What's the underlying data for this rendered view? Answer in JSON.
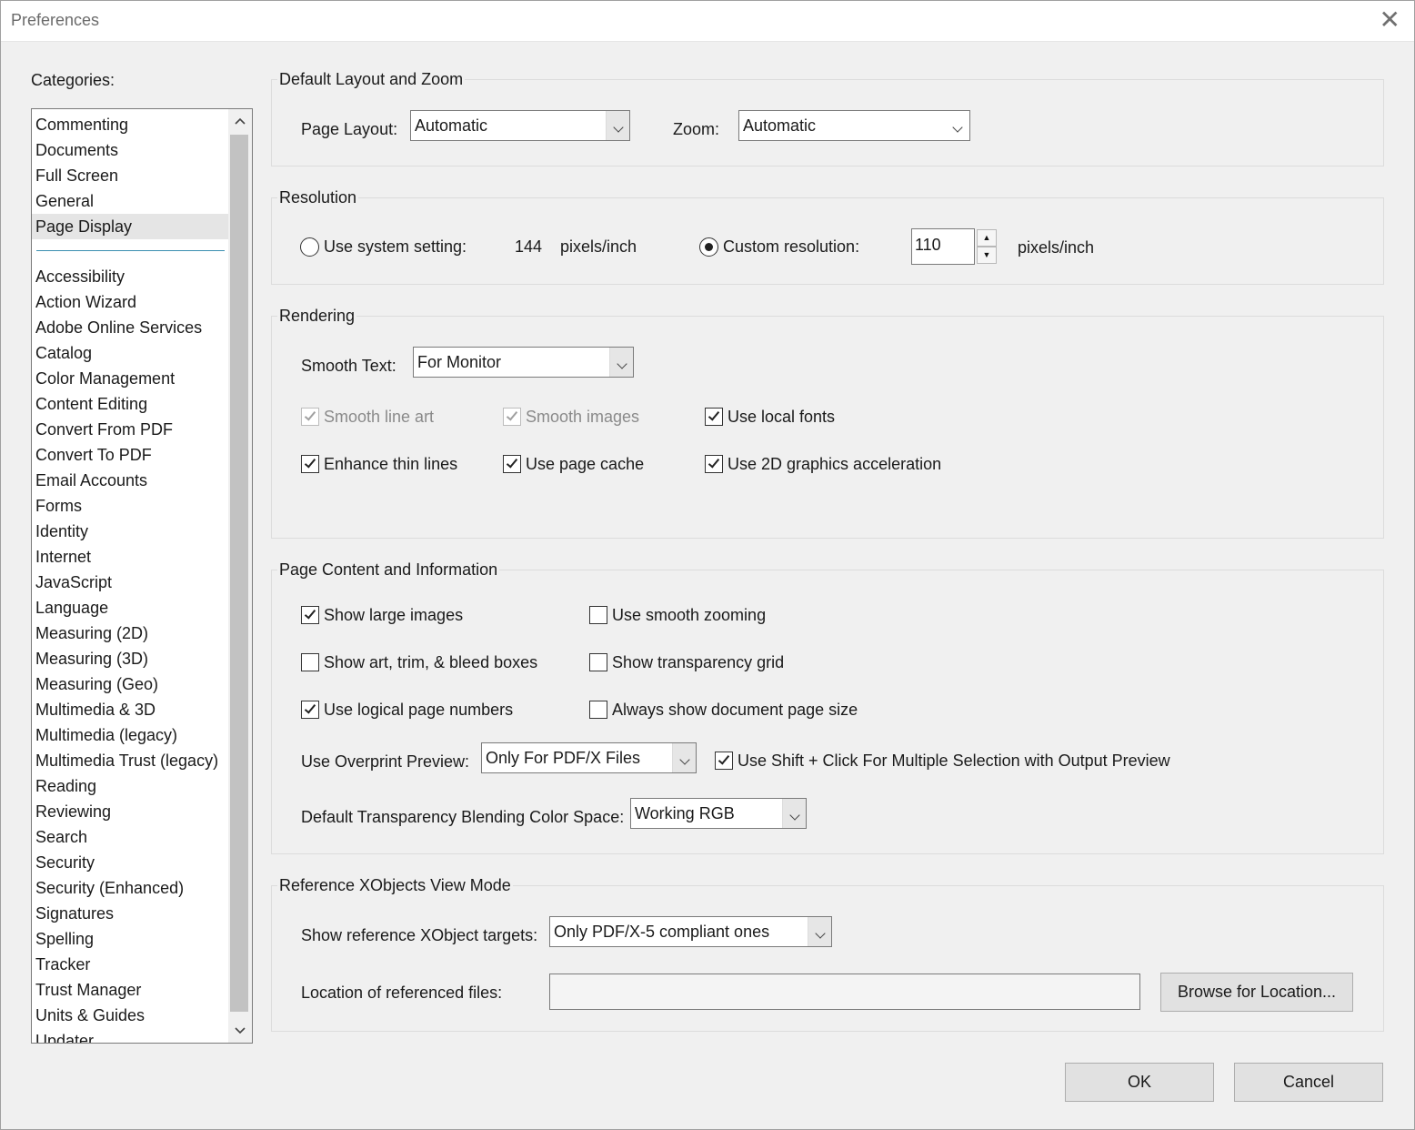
{
  "window": {
    "title": "Preferences",
    "close_glyph": "✕"
  },
  "categories": {
    "label": "Categories:",
    "top_items": [
      "Commenting",
      "Documents",
      "Full Screen",
      "General",
      "Page Display"
    ],
    "selected": "Page Display",
    "items": [
      "Accessibility",
      "Action Wizard",
      "Adobe Online Services",
      "Catalog",
      "Color Management",
      "Content Editing",
      "Convert From PDF",
      "Convert To PDF",
      "Email Accounts",
      "Forms",
      "Identity",
      "Internet",
      "JavaScript",
      "Language",
      "Measuring (2D)",
      "Measuring (3D)",
      "Measuring (Geo)",
      "Multimedia & 3D",
      "Multimedia (legacy)",
      "Multimedia Trust (legacy)",
      "Reading",
      "Reviewing",
      "Search",
      "Security",
      "Security (Enhanced)",
      "Signatures",
      "Spelling",
      "Tracker",
      "Trust Manager",
      "Units & Guides",
      "Updater"
    ]
  },
  "layout_zoom": {
    "title": "Default Layout and Zoom",
    "page_layout_label": "Page Layout:",
    "page_layout_value": "Automatic",
    "zoom_label": "Zoom:",
    "zoom_value": "Automatic"
  },
  "resolution": {
    "title": "Resolution",
    "system_label": "Use system setting:",
    "system_value": "144",
    "system_unit": "pixels/inch",
    "custom_label": "Custom resolution:",
    "custom_value": "110",
    "custom_unit": "pixels/inch",
    "selected": "custom"
  },
  "rendering": {
    "title": "Rendering",
    "smooth_text_label": "Smooth Text:",
    "smooth_text_value": "For Monitor",
    "smooth_line_art": {
      "label": "Smooth line art",
      "checked": true,
      "disabled": true
    },
    "smooth_images": {
      "label": "Smooth images",
      "checked": true,
      "disabled": true
    },
    "use_local_fonts": {
      "label": "Use local fonts",
      "checked": true
    },
    "enhance_thin_lines": {
      "label": "Enhance thin lines",
      "checked": true
    },
    "use_page_cache": {
      "label": "Use page cache",
      "checked": true
    },
    "use_2d_accel": {
      "label": "Use 2D graphics acceleration",
      "checked": true
    }
  },
  "page_content": {
    "title": "Page Content and Information",
    "show_large_images": {
      "label": "Show large images",
      "checked": true
    },
    "use_smooth_zooming": {
      "label": "Use smooth zooming",
      "checked": false
    },
    "show_art_boxes": {
      "label": "Show art, trim, & bleed boxes",
      "checked": false
    },
    "show_transparency_grid": {
      "label": "Show transparency grid",
      "checked": false
    },
    "use_logical_page_numbers": {
      "label": "Use logical page numbers",
      "checked": true
    },
    "always_show_page_size": {
      "label": "Always show document page size",
      "checked": false
    },
    "overprint_label": "Use Overprint Preview:",
    "overprint_value": "Only For PDF/X Files",
    "shift_click": {
      "label": "Use Shift + Click For Multiple Selection with Output Preview",
      "checked": true
    },
    "blending_label": "Default Transparency Blending Color Space:",
    "blending_value": "Working RGB"
  },
  "xobjects": {
    "title": "Reference XObjects View Mode",
    "targets_label": "Show reference XObject targets:",
    "targets_value": "Only PDF/X-5 compliant ones",
    "location_label": "Location of referenced files:",
    "location_value": "",
    "browse_label": "Browse for Location..."
  },
  "footer": {
    "ok_label": "OK",
    "cancel_label": "Cancel"
  }
}
